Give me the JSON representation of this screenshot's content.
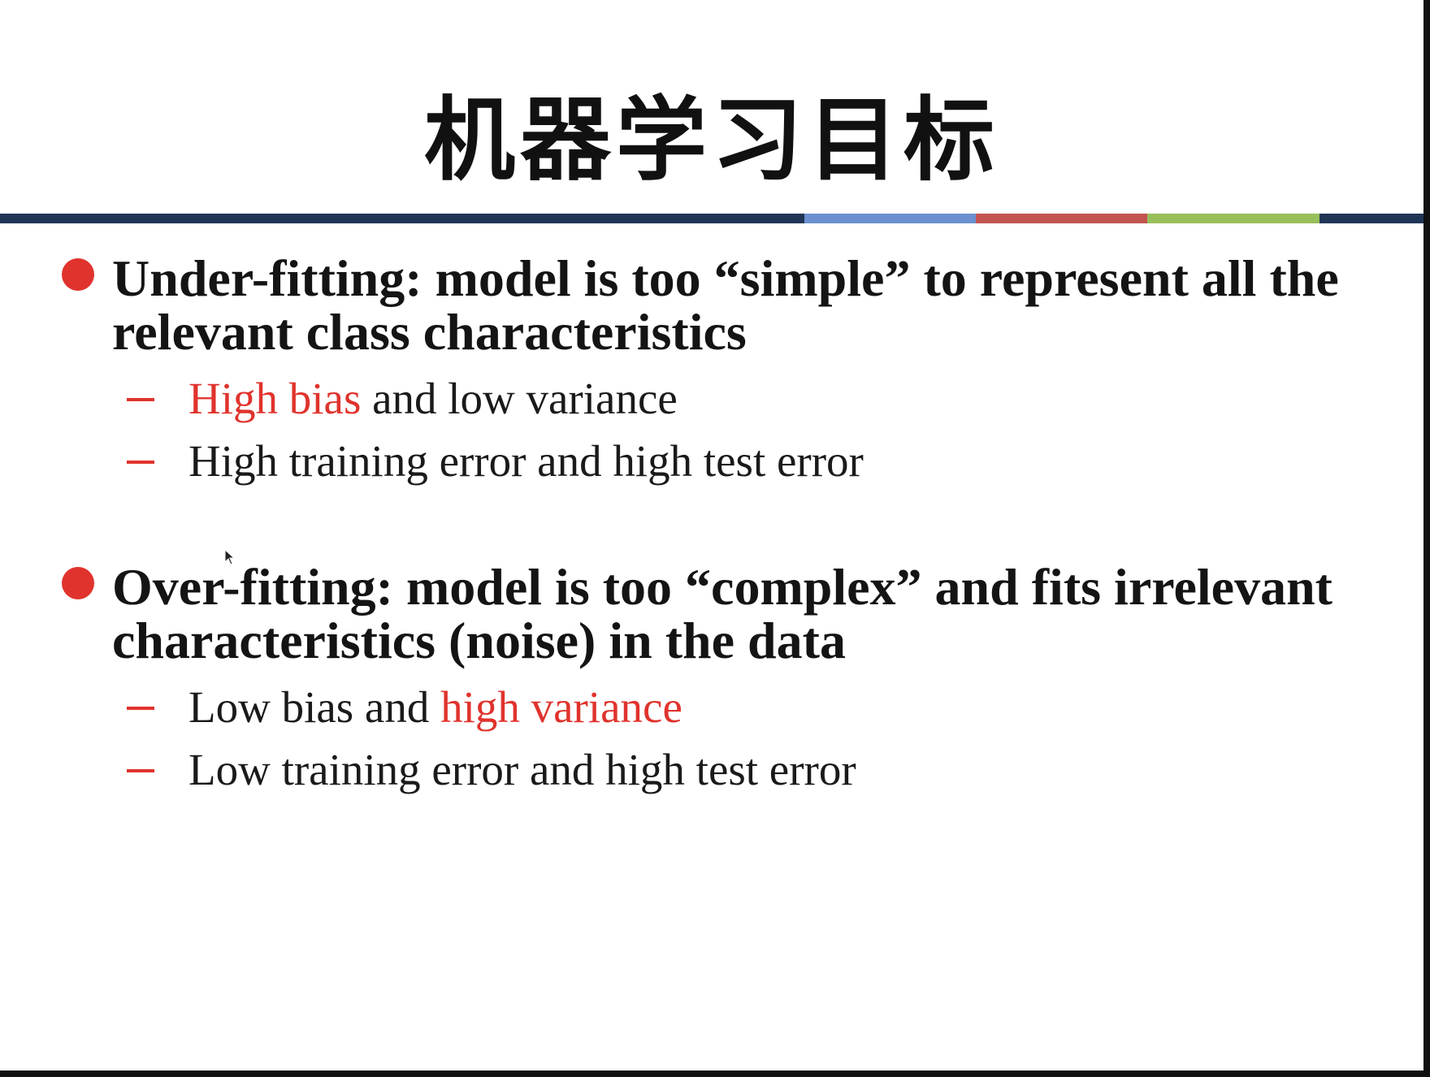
{
  "slide": {
    "title": "机器学习目标",
    "rule_colors": [
      "#1f3557",
      "#6b8fcf",
      "#c25450",
      "#98bf5a",
      "#1f3557"
    ],
    "accent_color": "#e0332d",
    "underfitting": {
      "heading": "Under-fitting: model is too “simple” to represent all the relevant class characteristics",
      "items": [
        {
          "highlight": "High bias",
          "rest": " and low variance"
        },
        {
          "text": "High training error and high test error"
        }
      ]
    },
    "overfitting": {
      "heading": "Over-fitting: model is too “complex” and fits irrelevant characteristics (noise) in the data",
      "items": [
        {
          "lead": "Low bias and ",
          "highlight": "high variance"
        },
        {
          "text": "Low training error and high test error"
        }
      ]
    }
  }
}
